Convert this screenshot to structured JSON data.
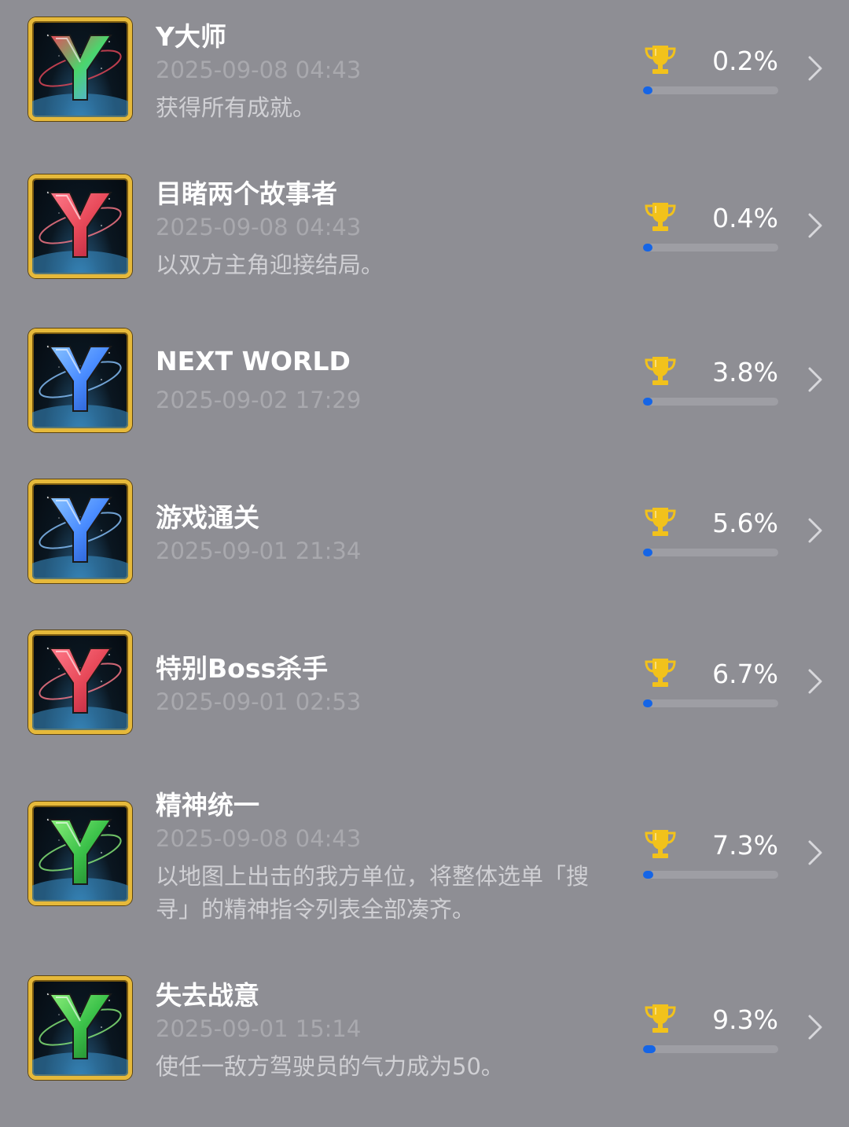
{
  "colors": {
    "background": "#8e8e94",
    "progress_fill": "#1565e6",
    "progress_track": "#9e9ea4",
    "trophy": "#f2c21b",
    "icon_border": "#e6b93a"
  },
  "achievements": [
    {
      "title": "Y大师",
      "date": "2025-09-08 04:43",
      "desc": "获得所有成就。",
      "percent_label": "0.2%",
      "percent": 0.2,
      "icon": "y-emblem-rainbow-icon",
      "y_colors": [
        "#4ad66d",
        "#e8495a",
        "#5aa0ff"
      ]
    },
    {
      "title": "目睹两个故事者",
      "date": "2025-09-08 04:43",
      "desc": "以双方主角迎接结局。",
      "percent_label": "0.4%",
      "percent": 0.4,
      "icon": "y-emblem-red-icon",
      "y_colors": [
        "#e84a5a",
        "#ff7a8a",
        "#b0203a"
      ]
    },
    {
      "title": "NEXT WORLD",
      "date": "2025-09-02 17:29",
      "desc": "",
      "percent_label": "3.8%",
      "percent": 3.8,
      "icon": "y-emblem-blue-icon",
      "y_colors": [
        "#4a8cff",
        "#8ac4ff",
        "#2050c0"
      ]
    },
    {
      "title": "游戏通关",
      "date": "2025-09-01 21:34",
      "desc": "",
      "percent_label": "5.6%",
      "percent": 5.6,
      "icon": "y-emblem-blue-icon",
      "y_colors": [
        "#4a8cff",
        "#8ac4ff",
        "#2050c0"
      ]
    },
    {
      "title": "特别Boss杀手",
      "date": "2025-09-01 02:53",
      "desc": "",
      "percent_label": "6.7%",
      "percent": 6.7,
      "icon": "y-emblem-red-icon",
      "y_colors": [
        "#e84a5a",
        "#ff7a8a",
        "#b0203a"
      ]
    },
    {
      "title": "精神统一",
      "date": "2025-09-08 04:43",
      "desc": "以地图上出击的我方单位，将整体选单「搜寻」的精神指令列表全部凑齐。",
      "percent_label": "7.3%",
      "percent": 7.3,
      "icon": "y-emblem-green-icon",
      "y_colors": [
        "#3cc24a",
        "#8aee7a",
        "#1c7a28"
      ]
    },
    {
      "title": "失去战意",
      "date": "2025-09-01 15:14",
      "desc": "使任一敌方驾驶员的气力成为50。",
      "percent_label": "9.3%",
      "percent": 9.3,
      "icon": "y-emblem-green-icon",
      "y_colors": [
        "#3cc24a",
        "#8aee7a",
        "#1c7a28"
      ]
    }
  ]
}
